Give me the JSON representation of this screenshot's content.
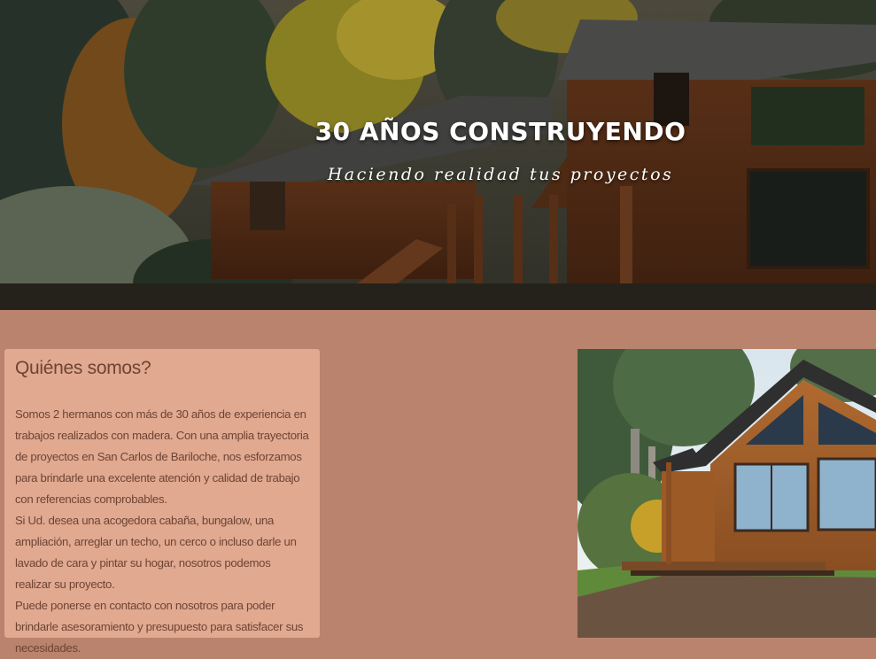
{
  "hero": {
    "title": "30 AÑOS CONSTRUYENDO",
    "subtitle": "Haciendo realidad tus proyectos"
  },
  "about": {
    "heading": "Quiénes somos?",
    "paragraphs": [
      "Somos 2 hermanos con más de 30 años de experiencia en trabajos realizados con madera. Con una amplia trayectoria de proyectos en San Carlos de Bariloche, nos esforzamos para brindarle una excelente atención y calidad de trabajo con referencias comprobables.",
      "Si Ud. desea una acogedora cabaña, bungalow, una ampliación, arreglar un techo, un cerco o incluso darle un lavado de cara y pintar su hogar, nosotros podemos realizar su proyecto.",
      "Puede ponerse en contacto con nosotros para poder brindarle asesoramiento y presupuesto para satisfacer sus necesidades."
    ]
  },
  "colors": {
    "page_background": "#b9836d",
    "card_background": "#e0a990",
    "card_text": "#6e4435"
  }
}
